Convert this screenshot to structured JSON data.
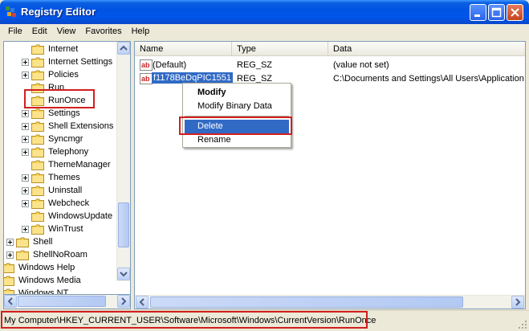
{
  "window": {
    "title": "Registry Editor"
  },
  "menu": [
    "File",
    "Edit",
    "View",
    "Favorites",
    "Help"
  ],
  "tree": {
    "items": [
      {
        "label": "Internet",
        "expander": false,
        "indent": 1
      },
      {
        "label": "Internet Settings",
        "expander": true,
        "indent": 1
      },
      {
        "label": "Policies",
        "expander": true,
        "indent": 1
      },
      {
        "label": "Run",
        "expander": false,
        "indent": 1
      },
      {
        "label": "RunOnce",
        "expander": false,
        "indent": 1
      },
      {
        "label": "Settings",
        "expander": true,
        "indent": 1
      },
      {
        "label": "Shell Extensions",
        "expander": true,
        "indent": 1
      },
      {
        "label": "Syncmgr",
        "expander": true,
        "indent": 1
      },
      {
        "label": "Telephony",
        "expander": true,
        "indent": 1
      },
      {
        "label": "ThemeManager",
        "expander": false,
        "indent": 1
      },
      {
        "label": "Themes",
        "expander": true,
        "indent": 1
      },
      {
        "label": "Uninstall",
        "expander": true,
        "indent": 1
      },
      {
        "label": "Webcheck",
        "expander": true,
        "indent": 1
      },
      {
        "label": "WindowsUpdate",
        "expander": false,
        "indent": 1
      },
      {
        "label": "WinTrust",
        "expander": true,
        "indent": 1
      },
      {
        "label": "Shell",
        "expander": true,
        "indent": 0
      },
      {
        "label": "ShellNoRoam",
        "expander": true,
        "indent": 0
      },
      {
        "label": "Windows Help",
        "expander": false,
        "indent": -1
      },
      {
        "label": "Windows Media",
        "expander": false,
        "indent": -1
      },
      {
        "label": "Windows NT",
        "expander": false,
        "indent": -1
      }
    ]
  },
  "list": {
    "columns": [
      "Name",
      "Type",
      "Data"
    ],
    "rows": [
      {
        "name": "(Default)",
        "type": "REG_SZ",
        "data": "(value not set)",
        "selected": false
      },
      {
        "name": "f1178BeDqPIC1551",
        "type": "REG_SZ",
        "data": "C:\\Documents and Settings\\All Users\\Application D",
        "selected": true
      }
    ]
  },
  "context_menu": {
    "items": [
      {
        "label": "Modify",
        "bold": true
      },
      {
        "label": "Modify Binary Data"
      },
      {
        "separator": true
      },
      {
        "label": "Delete",
        "hover": true
      },
      {
        "label": "Rename"
      }
    ]
  },
  "status": {
    "path": "My Computer\\HKEY_CURRENT_USER\\Software\\Microsoft\\Windows\\CurrentVersion\\RunOnce"
  },
  "colors": {
    "highlight": "#d21f1f",
    "selection": "#316ac5",
    "titlebar": "#0054e3"
  }
}
